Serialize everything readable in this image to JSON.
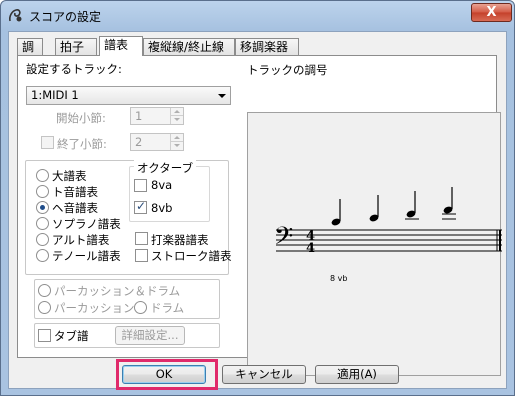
{
  "window": {
    "title": "スコアの設定",
    "close_symbol": "X"
  },
  "tabs": [
    {
      "label": "調",
      "active": false
    },
    {
      "label": "拍子",
      "active": false
    },
    {
      "label": "譜表",
      "active": true
    },
    {
      "label": "複縦線/終止線",
      "active": false
    },
    {
      "label": "移調楽器",
      "active": false
    }
  ],
  "track": {
    "label": "設定するトラック:",
    "selected": "1:MIDI 1"
  },
  "measures": {
    "start_label": "開始小節:",
    "start_value": "1",
    "end_label": "終了小節:",
    "end_value": "2"
  },
  "clefs": {
    "grand": "大譜表",
    "treble": "ト音譜表",
    "bass": "ヘ音譜表",
    "soprano": "ソプラノ譜表",
    "alto": "アルト譜表",
    "tenor": "テノール譜表",
    "percussion": "打楽器譜表",
    "stroke": "ストローク譜表",
    "selected": "bass"
  },
  "octave": {
    "label": "オクターブ",
    "va": "8va",
    "vb": "8vb",
    "va_checked": false,
    "vb_checked": true
  },
  "drums": {
    "perc_drum": "パーカッション＆ドラム",
    "percussion": "パーカッション",
    "drum": "ドラム"
  },
  "tab": {
    "label": "タブ譜",
    "detail_button": "詳細設定..."
  },
  "preview": {
    "label": "トラックの調号",
    "clef_symbol": "𝄢",
    "time_top": "4",
    "time_bottom": "4",
    "octave_marking": "8 vb"
  },
  "buttons": {
    "ok": "OK",
    "cancel": "キャンセル",
    "apply": "適用(A)"
  },
  "colors": {
    "highlight": "#e02a6b",
    "title_gradient": "#a9c3e1"
  }
}
